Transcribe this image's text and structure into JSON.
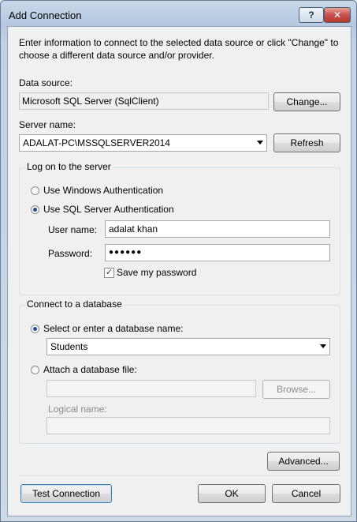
{
  "window": {
    "title": "Add Connection",
    "help_label": "?",
    "close_label": "✕"
  },
  "intro_text": "Enter information to connect to the selected data source or click \"Change\" to choose a different data source and/or provider.",
  "data_source": {
    "label": "Data source:",
    "value": "Microsoft SQL Server (SqlClient)",
    "change_label": "Change..."
  },
  "server": {
    "label": "Server name:",
    "value": "ADALAT-PC\\MSSQLSERVER2014",
    "refresh_label": "Refresh"
  },
  "logon": {
    "group_title": "Log on to the server",
    "windows_auth_label": "Use Windows Authentication",
    "sql_auth_label": "Use SQL Server Authentication",
    "username_label": "User name:",
    "username_value": "adalat khan",
    "password_label": "Password:",
    "password_value": "●●●●●●",
    "save_password_label": "Save my password",
    "save_password_checked": "✓"
  },
  "database": {
    "group_title": "Connect to a database",
    "select_label": "Select or enter a database name:",
    "select_value": "Students",
    "attach_label": "Attach a database file:",
    "browse_label": "Browse...",
    "logical_name_label": "Logical name:"
  },
  "buttons": {
    "advanced": "Advanced...",
    "test_connection": "Test Connection",
    "ok": "OK",
    "cancel": "Cancel"
  }
}
